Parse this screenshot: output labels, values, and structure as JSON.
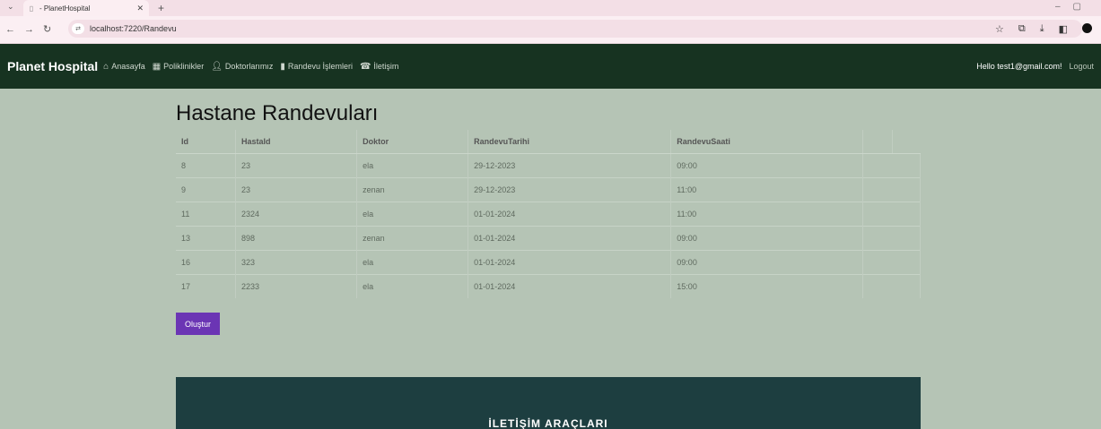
{
  "browser": {
    "tab_title": "- PlanetHospital",
    "url": "localhost:7220/Randevu"
  },
  "navbar": {
    "brand": "Planet Hospital",
    "links": [
      {
        "label": "Anasayfa",
        "icon": "home-icon"
      },
      {
        "label": "Poliklinikler",
        "icon": "hospital-icon"
      },
      {
        "label": "Doktorlarımız",
        "icon": "user-icon"
      },
      {
        "label": "Randevu İşlemleri",
        "icon": "book-icon"
      },
      {
        "label": "İletişim",
        "icon": "phone-icon"
      }
    ],
    "greeting": "Hello test1@gmail.com!",
    "logout": "Logout"
  },
  "page": {
    "title": "Hastane Randevuları",
    "create_button": "Oluştur"
  },
  "table": {
    "headers": [
      "Id",
      "HastaId",
      "Doktor",
      "RandevuTarihi",
      "RandevuSaati"
    ],
    "rows": [
      [
        "8",
        "23",
        "ela",
        "29-12-2023",
        "09:00"
      ],
      [
        "9",
        "23",
        "zenan",
        "29-12-2023",
        "11:00"
      ],
      [
        "11",
        "2324",
        "ela",
        "01-01-2024",
        "11:00"
      ],
      [
        "13",
        "898",
        "zenan",
        "01-01-2024",
        "09:00"
      ],
      [
        "16",
        "323",
        "ela",
        "01-01-2024",
        "09:00"
      ],
      [
        "17",
        "2233",
        "ela",
        "01-01-2024",
        "15:00"
      ]
    ]
  },
  "footer": {
    "title": "İLETİŞİM ARAÇLARI"
  }
}
